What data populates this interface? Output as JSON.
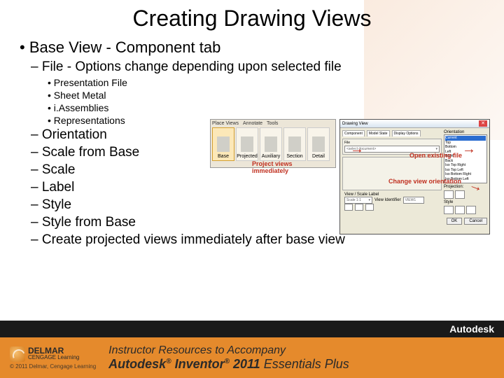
{
  "title": "Creating Drawing Views",
  "bullets": {
    "lvl1": "Base View - Component tab",
    "lvl2_file": "File - Options change depending upon selected file",
    "lvl3": [
      "Presentation File",
      "Sheet Metal",
      "i.Assemblies",
      "Representations"
    ],
    "lvl2_rest": [
      "Orientation",
      "Scale from Base",
      "Scale",
      "Label",
      "Style",
      "Style from Base",
      "Create projected views immediately after base view"
    ]
  },
  "ribbon": {
    "tabs": [
      "Place Views",
      "Annotate",
      "Tools"
    ],
    "icons": [
      "Base",
      "Projected",
      "Auxiliary",
      "Section",
      "Detail"
    ]
  },
  "dialog": {
    "title": "Drawing View",
    "tabs": [
      "Component",
      "Model State",
      "Display Options"
    ],
    "file_label": "File",
    "file_placeholder": "<select document>",
    "orient_label": "Orientation",
    "orient_items": [
      "Current",
      "Top",
      "Bottom",
      "Left",
      "Right",
      "Back",
      "Iso Top Right",
      "Iso Top Left",
      "Iso Bottom Right",
      "Iso Bottom Left"
    ],
    "proj_label": "Projection:",
    "style_label": "Style",
    "scale_label": "View / Scale Label",
    "scale_val": "Scale 1:1",
    "view_id_label": "View Identifier",
    "view_id_val": "VIEW1",
    "ok": "OK",
    "cancel": "Cancel"
  },
  "annotations": {
    "a1": "Project views immediately",
    "a2": "Open existing file",
    "a3": "Change view orientation"
  },
  "footer": {
    "brand": "Autodesk",
    "delmar": "DELMAR",
    "cengage": "CENGAGE Learning",
    "copyright": "© 2011 Delmar, Cengage Learning",
    "line1": "Instructor Resources to Accompany",
    "line2a": "Autodesk",
    "line2b": "Inventor",
    "line2c": "2011",
    "line2d": "Essentials Plus"
  }
}
